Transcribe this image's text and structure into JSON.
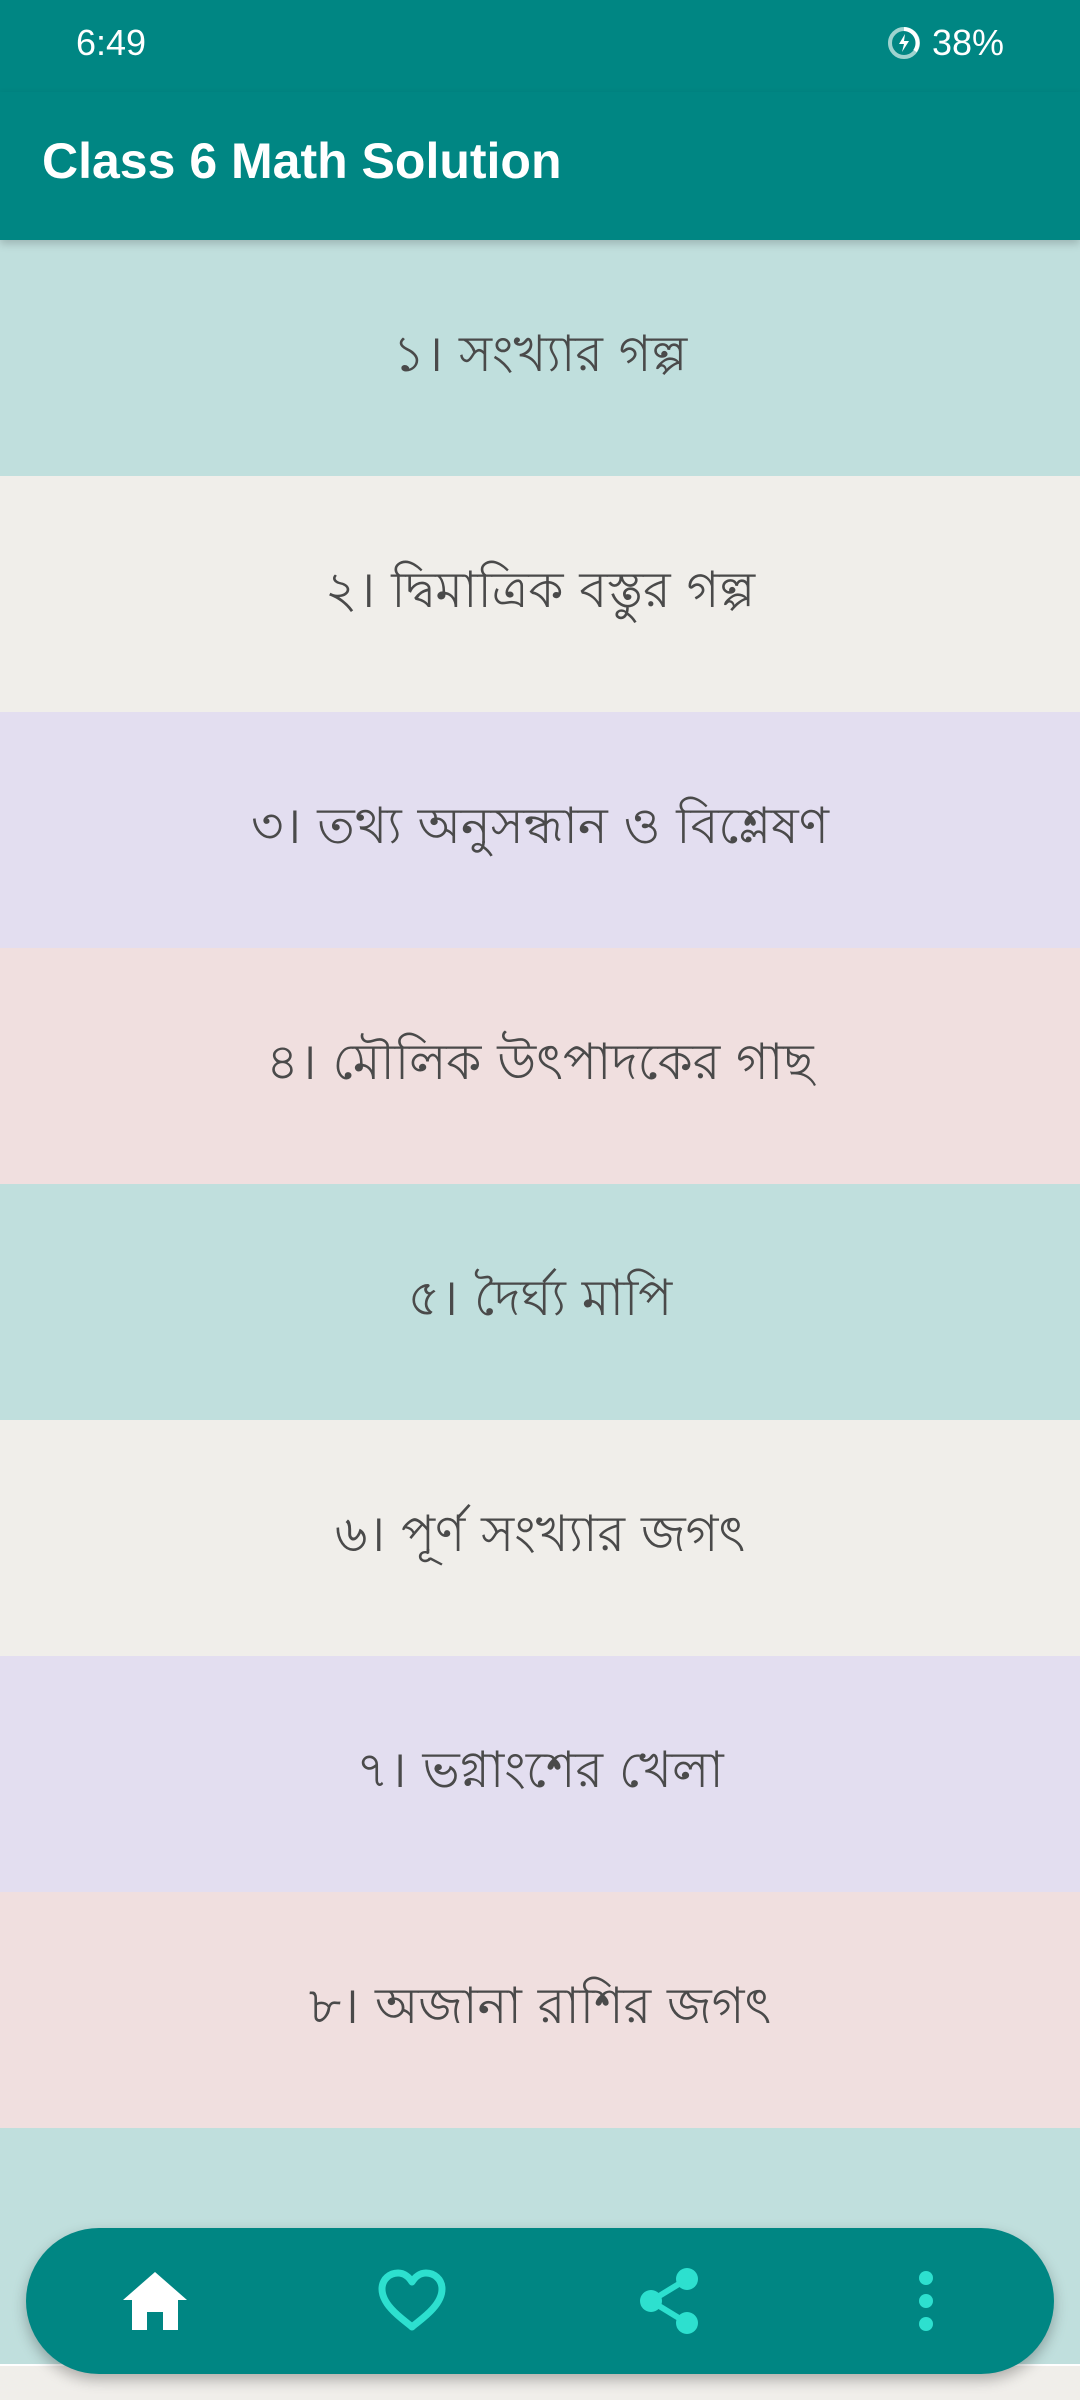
{
  "status_bar": {
    "time": "6:49",
    "battery": "38%"
  },
  "app_bar": {
    "title": "Class 6 Math Solution"
  },
  "chapters": [
    {
      "label": "১। সংখ্যার গল্প",
      "bg": "#c0dfdd"
    },
    {
      "label": "২। দ্বিমাত্রিক বস্তুর গল্প",
      "bg": "#f0eeea"
    },
    {
      "label": "৩। তথ্য অনুসন্ধান ও বিশ্লেষণ",
      "bg": "#e3def0"
    },
    {
      "label": "৪। মৌলিক উৎপাদকের গাছ",
      "bg": "#f0dfdf"
    },
    {
      "label": "৫। দৈর্ঘ্য মাপি",
      "bg": "#c0dfdd"
    },
    {
      "label": "৬। পূর্ণ সংখ্যার জগৎ",
      "bg": "#f0eeea"
    },
    {
      "label": "৭। ভগ্নাংশের খেলা",
      "bg": "#e3def0"
    },
    {
      "label": "৮। অজানা রাশির জগৎ",
      "bg": "#f0dfdf"
    },
    {
      "label": "",
      "bg": "#c0dfdd"
    }
  ],
  "bottom_nav": {
    "items": [
      {
        "icon": "home-icon",
        "color": "#ffffff"
      },
      {
        "icon": "heart-icon",
        "color": "#2de0cf"
      },
      {
        "icon": "share-icon",
        "color": "#2de0cf"
      },
      {
        "icon": "more-vert-icon",
        "color": "#2de0cf"
      }
    ]
  },
  "colors": {
    "primary": "#008683",
    "accent": "#2de0cf"
  }
}
